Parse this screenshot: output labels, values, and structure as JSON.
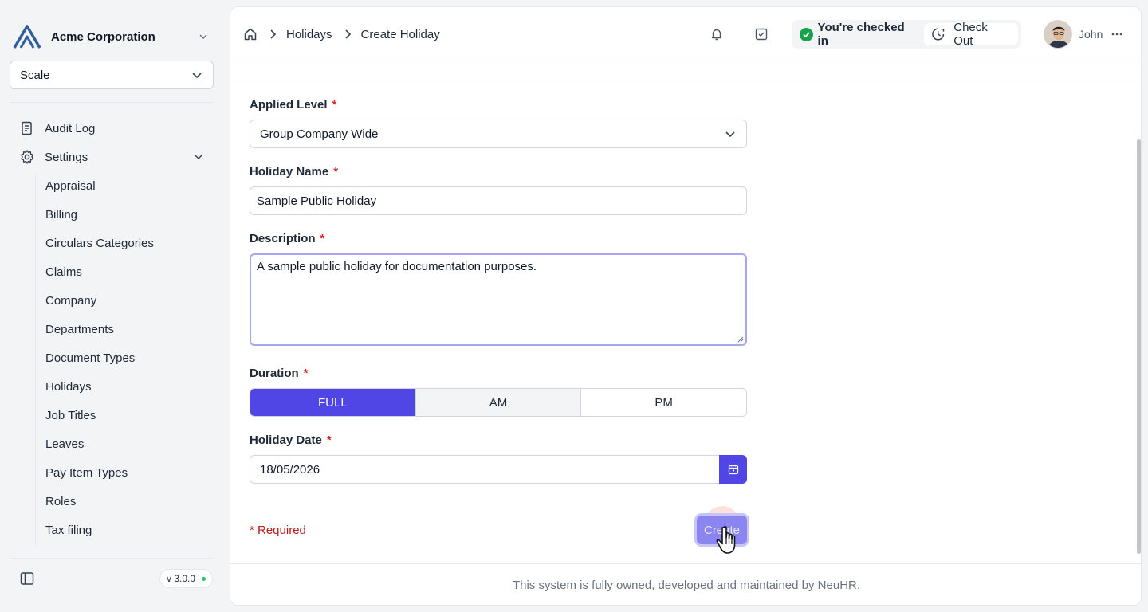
{
  "sidebar": {
    "org_name": "Acme Corporation",
    "scale_select": "Scale",
    "items": [
      {
        "label": "Audit Log",
        "icon": "audit-log-icon"
      },
      {
        "label": "Settings",
        "icon": "gear-icon"
      }
    ],
    "settings_children": [
      "Appraisal",
      "Billing",
      "Circulars Categories",
      "Claims",
      "Company",
      "Departments",
      "Document Types",
      "Holidays",
      "Job Titles",
      "Leaves",
      "Pay Item Types",
      "Roles",
      "Tax filing"
    ],
    "version": "v 3.0.0"
  },
  "header": {
    "breadcrumb": [
      "Holidays",
      "Create Holiday"
    ],
    "checkin_status": "You're checked in",
    "checkout_label": "Check Out",
    "user_name": "John"
  },
  "form": {
    "applied_level": {
      "label": "Applied Level",
      "value": "Group Company Wide"
    },
    "holiday_name": {
      "label": "Holiday Name",
      "value": "Sample Public Holiday"
    },
    "description": {
      "label": "Description",
      "value": "A sample public holiday for documentation purposes."
    },
    "duration": {
      "label": "Duration",
      "options": [
        "FULL",
        "AM",
        "PM"
      ],
      "selected": "FULL"
    },
    "holiday_date": {
      "label": "Holiday Date",
      "value": "18/05/2026"
    },
    "required_marker": "*",
    "required_note": "* Required",
    "submit_label": "Create"
  },
  "footer": {
    "text": "This system is fully owned, developed and maintained by NeuHR."
  },
  "colors": {
    "accent": "#4f46e5",
    "success": "#16a34a",
    "required": "#dc2626"
  }
}
